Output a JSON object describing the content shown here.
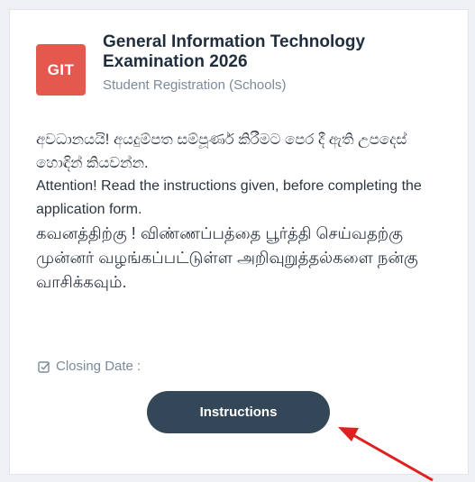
{
  "card": {
    "badge": "GIT",
    "title": "General Information Technology Examination 2026",
    "subtitle": "Student Registration (Schools)",
    "notice_sinhala": "අවධානයයි! අයදුම්පත සම්පූර්ණ කිරීමට පෙර දී ඇති උපදෙස් හොඳින් කියවන්න.",
    "notice_english": "Attention! Read the instructions given, before completing the application form.",
    "notice_tamil": "கவனத்திற்கு ! விண்ணப்பத்தை பூர்த்தி செய்வதற்கு முன்னர் வழங்கப்பட்டுள்ள அறிவுறுத்தல்களை நன்கு வாசிக்கவும்.",
    "closing_date_label": "Closing Date :",
    "instructions_button": "Instructions"
  },
  "icons": {
    "closing_date": "checkbox-calendar-icon",
    "annotation": "red-arrow"
  },
  "colors": {
    "badge": "#e4584d",
    "button": "#344759",
    "arrow": "#e02020"
  }
}
